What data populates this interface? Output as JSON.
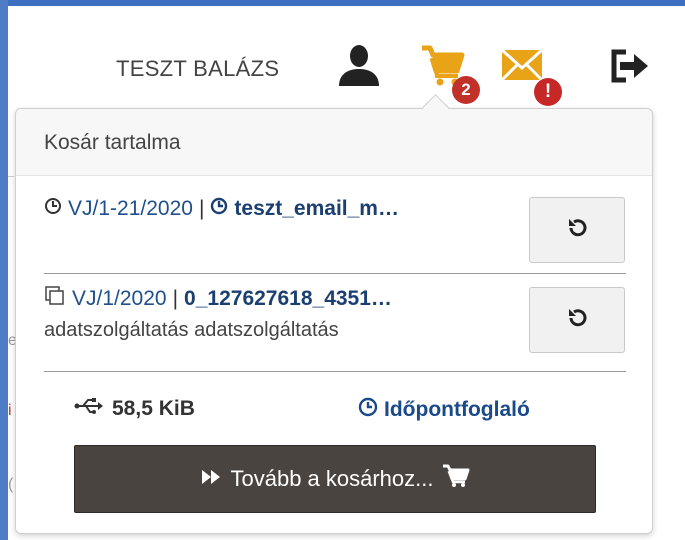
{
  "header": {
    "username": "TESZT BALÁZS",
    "icons": {
      "user": "user-icon",
      "cart": "cart-icon",
      "mail": "mail-icon",
      "logout": "logout-icon"
    },
    "cart_badge": "2",
    "mail_badge": "!",
    "colors": {
      "icon_yellow": "#e8a317",
      "badge_red": "#c2302a",
      "frame_blue": "#3d6fc0"
    }
  },
  "popover": {
    "title": "Kosár tartalma",
    "items": [
      {
        "ref": "VJ/1-21/2020",
        "separator": "|",
        "name": "teszt_email_m…",
        "description": "",
        "ref_icon": "clock-icon",
        "name_icon": "clock-icon",
        "action_icon": "refresh-icon"
      },
      {
        "ref": "VJ/1/2020",
        "separator": "|",
        "name": "0_127627618_4351…",
        "description": "adatszolgáltatás adatszolgáltatás",
        "ref_icon": "copy-icon",
        "action_icon": "refresh-icon"
      }
    ],
    "total_size": "58,5 KiB",
    "size_icon": "usb-icon",
    "booking_link": "Időpontfoglaló",
    "checkout_button": "Tovább a kosárhoz...",
    "colors": {
      "checkout_bg": "#4a4440",
      "link_blue": "#1a4a8a"
    }
  },
  "background": {
    "fragments": [
      "e",
      "i",
      "("
    ]
  }
}
